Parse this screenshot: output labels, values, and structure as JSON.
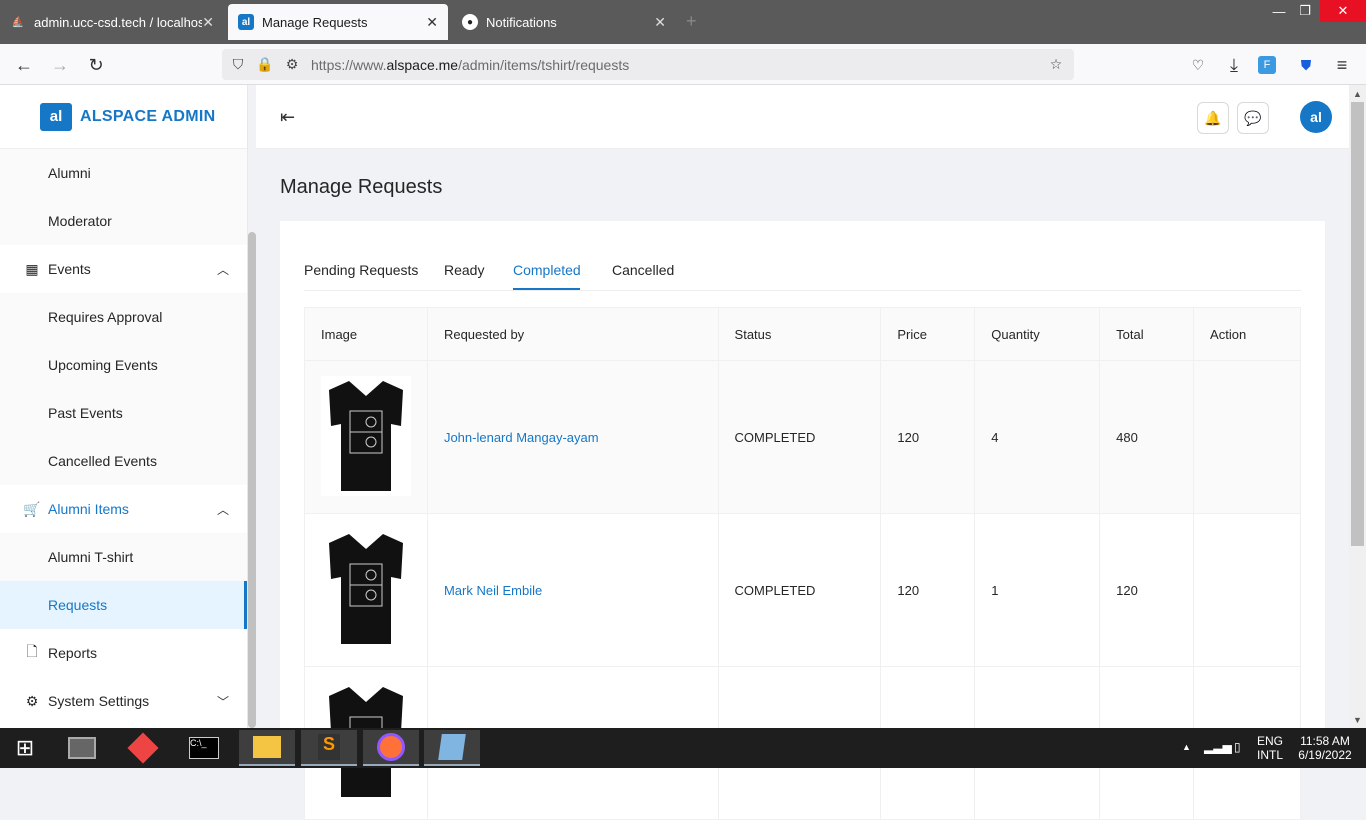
{
  "browser": {
    "tabs": [
      {
        "title": "admin.ucc-csd.tech / localhost",
        "active": false
      },
      {
        "title": "Manage Requests",
        "active": true
      },
      {
        "title": "Notifications",
        "active": false
      }
    ],
    "url_prefix": "https://www.",
    "url_domain": "alspace.me",
    "url_path": "/admin/items/tshirt/requests"
  },
  "brand": {
    "logo_text": "al",
    "name": "ALSPACE ADMIN"
  },
  "sidebar": {
    "items": [
      {
        "label": "Alumni"
      },
      {
        "label": "Moderator"
      },
      {
        "label": "Events"
      },
      {
        "label": "Requires Approval"
      },
      {
        "label": "Upcoming Events"
      },
      {
        "label": "Past Events"
      },
      {
        "label": "Cancelled Events"
      },
      {
        "label": "Alumni Items"
      },
      {
        "label": "Alumni T-shirt"
      },
      {
        "label": "Requests"
      },
      {
        "label": "Reports"
      },
      {
        "label": "System Settings"
      }
    ]
  },
  "header": {
    "avatar_text": "al"
  },
  "page": {
    "title": "Manage Requests"
  },
  "tabs": [
    "Pending Requests",
    "Ready",
    "Completed",
    "Cancelled"
  ],
  "table": {
    "columns": [
      "Image",
      "Requested by",
      "Status",
      "Price",
      "Quantity",
      "Total",
      "Action"
    ],
    "rows": [
      {
        "requested_by": "John-lenard Mangay-ayam",
        "status": "COMPLETED",
        "price": "120",
        "quantity": "4",
        "total": "480"
      },
      {
        "requested_by": "Mark Neil Embile",
        "status": "COMPLETED",
        "price": "120",
        "quantity": "1",
        "total": "120"
      }
    ]
  },
  "taskbar": {
    "lang1": "ENG",
    "lang2": "INTL",
    "time": "11:58 AM",
    "date": "6/19/2022"
  }
}
